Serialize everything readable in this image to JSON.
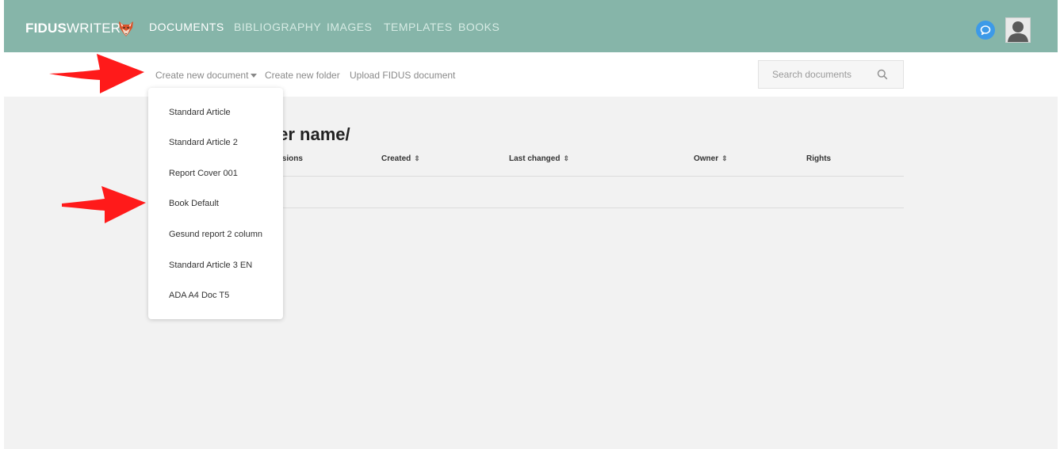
{
  "header": {
    "logo_bold": "FIDUS",
    "logo_light": "WRITER",
    "nav": [
      {
        "label": "DOCUMENTS",
        "active": true
      },
      {
        "label": "BIBLIOGRAPHY",
        "active": false
      },
      {
        "label": "IMAGES",
        "active": false
      },
      {
        "label": "TEMPLATES",
        "active": false
      },
      {
        "label": "BOOKS",
        "active": false
      }
    ],
    "icons": [
      "fox-logo-icon",
      "chat-icon",
      "user-avatar-icon"
    ]
  },
  "toolbar": {
    "create_document": "Create new document",
    "create_folder": "Create new folder",
    "upload": "Upload FIDUS document",
    "search": {
      "placeholder": "Search documents",
      "icon": "search-icon"
    }
  },
  "main": {
    "folder_title": "ler name/",
    "columns": [
      {
        "label": "isions",
        "sortable": false
      },
      {
        "label": "Created",
        "sortable": true
      },
      {
        "label": "Last changed",
        "sortable": true
      },
      {
        "label": "Owner",
        "sortable": true
      },
      {
        "label": "Rights",
        "sortable": false
      }
    ],
    "sort_glyph": "⇕"
  },
  "dropdown": {
    "items": [
      "Standard Article",
      "Standard Article 2",
      "Report Cover 001",
      "Book Default",
      "Gesund report 2 column",
      "Standard Article 3 EN",
      "ADA A4 Doc T5"
    ]
  },
  "colors": {
    "header_bg": "#86b5a9",
    "annotation_arrow": "#ff1a1a",
    "chat_button": "#3d9ae8"
  }
}
